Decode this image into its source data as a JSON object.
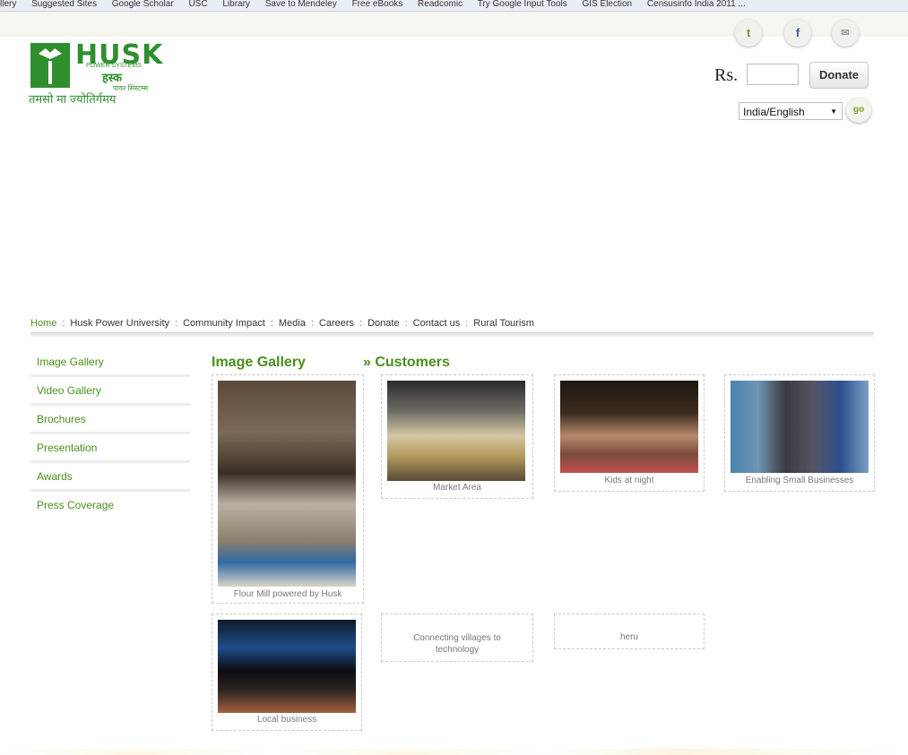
{
  "bookmarks_bar": [
    "llery",
    "Suggested Sites",
    "Google Scholar",
    "USC",
    "Library",
    "Save to Mendeley",
    "Free eBooks",
    "Readcomic",
    "Try Google Input Tools",
    "GIS Election",
    "Censusinfo India 2011 ..."
  ],
  "brand": {
    "name": "HUSK",
    "subtitle": "POWER SYSTEMS",
    "hindi_name": "हस्क",
    "hindi_sub": "पावर सिस्टम्स",
    "tagline": "तमसो मा ज्योतिर्गमय"
  },
  "social": {
    "twitter": "t",
    "facebook": "f",
    "mail": "✉"
  },
  "donate": {
    "currency": "Rs.",
    "amount_placeholder": "",
    "button": "Donate"
  },
  "language": {
    "selected": "India/English",
    "go": "go"
  },
  "nav": [
    "Home",
    "Husk Power University",
    "Community Impact",
    "Media",
    "Careers",
    "Donate",
    "Contact us",
    "Rural Tourism"
  ],
  "nav_separator": ":",
  "sidebar": [
    "Image Gallery",
    "Video Gallery",
    "Brochures",
    "Presentation",
    "Awards",
    "Press Coverage"
  ],
  "gallery": {
    "title": "Image Gallery",
    "section": "» Customers",
    "items": [
      {
        "caption": "Flour Mill powered by Husk"
      },
      {
        "caption": "Market Area"
      },
      {
        "caption": "Kids at night"
      },
      {
        "caption": "Enabling Small Businesses"
      },
      {
        "caption": "Local business"
      },
      {
        "caption": "Connecting villages to technology"
      },
      {
        "caption": "heru"
      }
    ]
  }
}
